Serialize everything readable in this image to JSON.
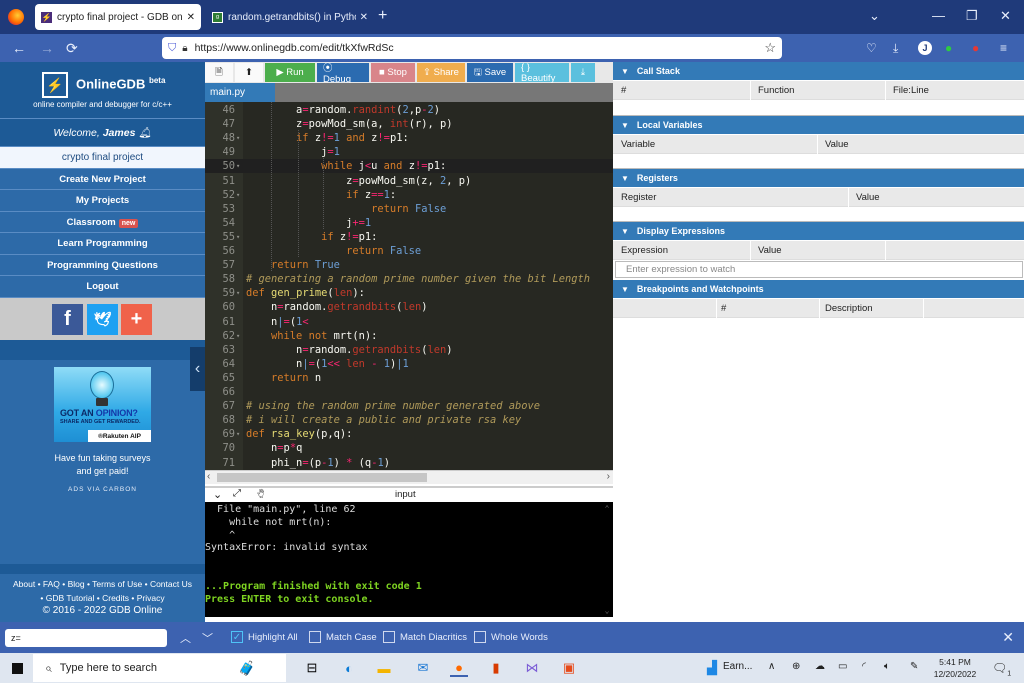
{
  "browser": {
    "tabs": [
      {
        "title": "crypto final project - GDB online",
        "favicon": "bolt-icon",
        "active": true
      },
      {
        "title": "random.getrandbits() in Python",
        "favicon": "gfg-icon",
        "active": false
      }
    ],
    "new_tab": "+",
    "url": "https://www.onlinegdb.com/edit/tkXfwRdSc",
    "icons": {
      "back": "←",
      "forward": "→",
      "reload": "⟳",
      "star": "☆",
      "list_all": "⌄",
      "minimize": "—",
      "maximize": "❐",
      "close": "✕",
      "menu": "≡",
      "profile": "J"
    }
  },
  "sidebar": {
    "brand": "OnlineGDB",
    "brand_sup": "beta",
    "tagline": "online compiler and debugger for c/c++",
    "welcome_prefix": "Welcome, ",
    "user": "James",
    "current_project": "crypto final project",
    "items": [
      {
        "label": "Create New Project"
      },
      {
        "label": "My Projects"
      },
      {
        "label": "Classroom",
        "badge": "new"
      },
      {
        "label": "Learn Programming"
      },
      {
        "label": "Programming Questions"
      },
      {
        "label": "Logout"
      }
    ],
    "social": {
      "facebook": "f",
      "twitter": "🐦",
      "more": "+"
    },
    "ad": {
      "headline_a": "GOT AN ",
      "headline_b": "OPINION?",
      "subline": "SHARE AND GET REWARDED.",
      "sponsor": "®Rakuten AIP",
      "text_line1": "Have fun taking surveys",
      "text_line2": "and get paid!",
      "via": "ADS VIA CARBON"
    },
    "footer_line1": "About • FAQ • Blog • Terms of Use • Contact Us",
    "footer_line2": "• GDB Tutorial • Credits • Privacy",
    "copyright": "© 2016 - 2022 GDB Online"
  },
  "toolbar": {
    "new_file": "🗎",
    "upload": "⬆",
    "run": "▶ Run",
    "debug": "⦿ Debug",
    "stop": "■ Stop",
    "share": "⇪ Share",
    "save": "🖫 Save",
    "beautify": "{ } Beautify",
    "download": "⤓"
  },
  "file_tab": "main.py",
  "editor": {
    "lines": [
      {
        "n": "46",
        "fold": false,
        "html": "        a<span class='op'>=</span>random.<span class='bt'>randint</span>(<span class='num'>2</span>,p<span class='op'>-</span><span class='num'>2</span>)"
      },
      {
        "n": "47",
        "fold": false,
        "html": "        z<span class='op'>=</span>powMod_sm(a, <span class='bt'>int</span>(r), p)"
      },
      {
        "n": "48",
        "fold": true,
        "html": "        <span class='kw'>if</span> z<span class='op'>!=</span><span class='num'>1</span> <span class='kw'>and</span> z<span class='op'>!=</span>p1:"
      },
      {
        "n": "49",
        "fold": false,
        "html": "            j<span class='op'>=</span><span class='num'>1</span>"
      },
      {
        "n": "50",
        "fold": true,
        "active": true,
        "html": "            <span class='kw'>while</span> j<span class='op'>&lt;</span>u <span class='kw'>and</span> z<span class='op'>!=</span>p1:"
      },
      {
        "n": "51",
        "fold": false,
        "html": "                z<span class='op'>=</span>powMod_sm(z, <span class='num'>2</span>, p)"
      },
      {
        "n": "52",
        "fold": true,
        "html": "                <span class='kw'>if</span> z<span class='op'>==</span><span class='num'>1</span>:"
      },
      {
        "n": "53",
        "fold": false,
        "html": "                    <span class='kw'>return</span> <span class='num'>False</span>"
      },
      {
        "n": "54",
        "fold": false,
        "html": "                j<span class='op'>+=</span><span class='num'>1</span>"
      },
      {
        "n": "55",
        "fold": true,
        "html": "            <span class='kw'>if</span> z<span class='op'>!=</span>p1:"
      },
      {
        "n": "56",
        "fold": false,
        "html": "                <span class='kw'>return</span> <span class='num'>False</span>"
      },
      {
        "n": "57",
        "fold": false,
        "html": "    <span class='kw'>return</span> <span class='num'>True</span>"
      },
      {
        "n": "58",
        "fold": false,
        "html": "<span class='cm'># generating a random prime number given the bit Length</span>"
      },
      {
        "n": "59",
        "fold": true,
        "html": "<span class='kw'>def</span> <span class='fn'>gen_prime</span>(<span class='bt'>len</span>):"
      },
      {
        "n": "60",
        "fold": false,
        "html": "    n<span class='op'>=</span>random.<span class='bt'>getrandbits</span>(<span class='bt'>len</span>)"
      },
      {
        "n": "61",
        "fold": false,
        "html": "    n<span class='num'>|</span><span class='op'>=</span>(<span class='num'>1</span><span class='op'>&lt;</span>"
      },
      {
        "n": "62",
        "fold": true,
        "html": "    <span class='kw'>while</span> <span class='kw'>not</span> mrt(n):"
      },
      {
        "n": "63",
        "fold": false,
        "html": "        n<span class='op'>=</span>random.<span class='bt'>getrandbits</span>(<span class='bt'>len</span>)"
      },
      {
        "n": "64",
        "fold": false,
        "html": "        n<span class='num'>|</span><span class='op'>=</span>(<span class='num'>1</span><span class='op'>&lt;&lt;</span> <span class='bt'>len</span> <span class='op'>-</span> <span class='num'>1</span>)<span class='num'>|1</span>"
      },
      {
        "n": "65",
        "fold": false,
        "html": "    <span class='kw'>return</span> n"
      },
      {
        "n": "66",
        "fold": false,
        "html": ""
      },
      {
        "n": "67",
        "fold": false,
        "html": "<span class='cm'># using the random prime number generated above</span>"
      },
      {
        "n": "68",
        "fold": false,
        "html": "<span class='cm'># i will create a public and private rsa key</span>"
      },
      {
        "n": "69",
        "fold": true,
        "html": "<span class='kw'>def</span> <span class='fn'>rsa_key</span>(p,q):"
      },
      {
        "n": "70",
        "fold": false,
        "html": "    n<span class='op'>=</span>p<span class='op'>*</span>q"
      },
      {
        "n": "71",
        "fold": false,
        "html": "    phi_n<span class='op'>=</span>(p<span class='op'>-</span><span class='num'>1</span>) <span class='op'>*</span> (q<span class='op'>-</span><span class='num'>1</span>)"
      }
    ]
  },
  "console": {
    "label": "input",
    "lines": [
      {
        "text": "  File \"main.py\", line 62",
        "style": ""
      },
      {
        "text": "    while not mrt(n):",
        "style": ""
      },
      {
        "text": "    ^",
        "style": ""
      },
      {
        "text": "SyntaxError: invalid syntax",
        "style": ""
      },
      {
        "text": "",
        "style": ""
      },
      {
        "text": "",
        "style": ""
      },
      {
        "text": "...Program finished with exit code 1",
        "style": "green"
      },
      {
        "text": "Press ENTER to exit console.",
        "style": "green"
      }
    ]
  },
  "debug": {
    "call_stack": {
      "title": "Call Stack",
      "cols": [
        "#",
        "Function",
        "File:Line"
      ]
    },
    "locals": {
      "title": "Local Variables",
      "cols": [
        "Variable",
        "Value"
      ]
    },
    "registers": {
      "title": "Registers",
      "cols": [
        "Register",
        "Value"
      ]
    },
    "display": {
      "title": "Display Expressions",
      "cols": [
        "Expression",
        "Value"
      ],
      "placeholder": "Enter expression to watch"
    },
    "breakpoints": {
      "title": "Breakpoints and Watchpoints",
      "cols": [
        "#",
        "Description"
      ]
    }
  },
  "findbar": {
    "query": "z=",
    "options": [
      {
        "label": "Highlight All",
        "checked": true
      },
      {
        "label": "Match Case",
        "checked": false
      },
      {
        "label": "Match Diacritics",
        "checked": false
      },
      {
        "label": "Whole Words",
        "checked": false
      }
    ]
  },
  "taskbar": {
    "search_placeholder": "Type here to search",
    "widget": "Earn...",
    "time": "5:41 PM",
    "date": "12/20/2022",
    "notifications": "1"
  }
}
